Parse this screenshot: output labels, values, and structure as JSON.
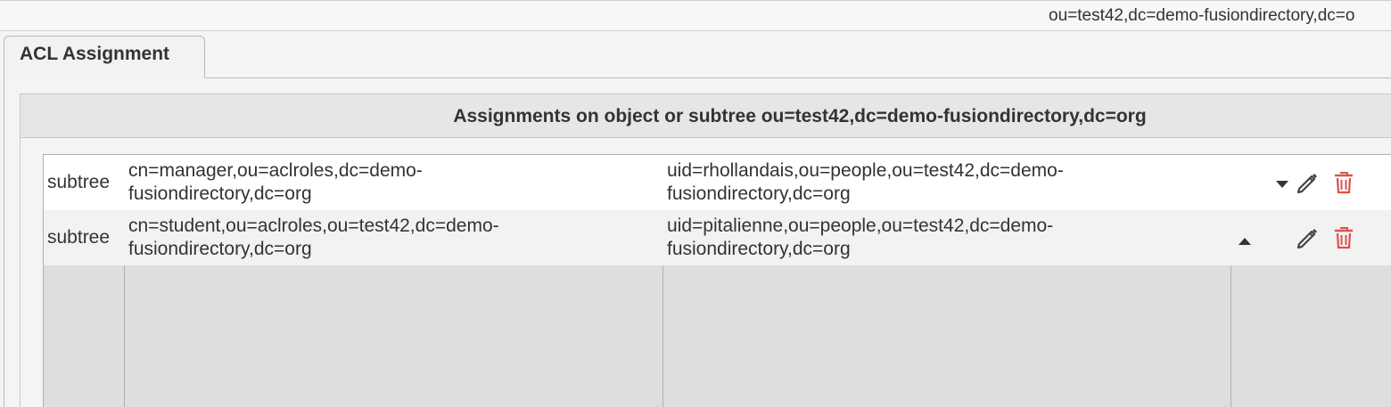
{
  "header": {
    "current_dn": "ou=test42,dc=demo-fusiondirectory,dc=o"
  },
  "tabs": [
    {
      "label": "ACL Assignment",
      "active": true
    }
  ],
  "section": {
    "title": "Assignments on object or subtree ou=test42,dc=demo-fusiondirectory,dc=org"
  },
  "assignments": [
    {
      "type": "subtree",
      "role_line1": "cn=manager,ou=aclroles,dc=demo-",
      "role_line2": "fusiondirectory,dc=org",
      "member_line1": "uid=rhollandais,ou=people,ou=test42,dc=demo-",
      "member_line2": "fusiondirectory,dc=org",
      "actions": [
        "move-down",
        "edit",
        "delete"
      ]
    },
    {
      "type": "subtree",
      "role_line1": "cn=student,ou=aclroles,ou=test42,dc=demo-",
      "role_line2": "fusiondirectory,dc=org",
      "member_line1": "uid=pitalienne,ou=people,ou=test42,dc=demo-",
      "member_line2": "fusiondirectory,dc=org",
      "actions": [
        "move-up",
        "edit",
        "delete"
      ]
    }
  ],
  "icons": {
    "move_down": "triangle-down-icon",
    "move_up": "triangle-up-icon",
    "edit": "pencil-icon",
    "delete": "trash-icon"
  },
  "colors": {
    "delete_icon": "#d9534f",
    "edit_icon": "#444444",
    "arrow_icon": "#333333"
  }
}
